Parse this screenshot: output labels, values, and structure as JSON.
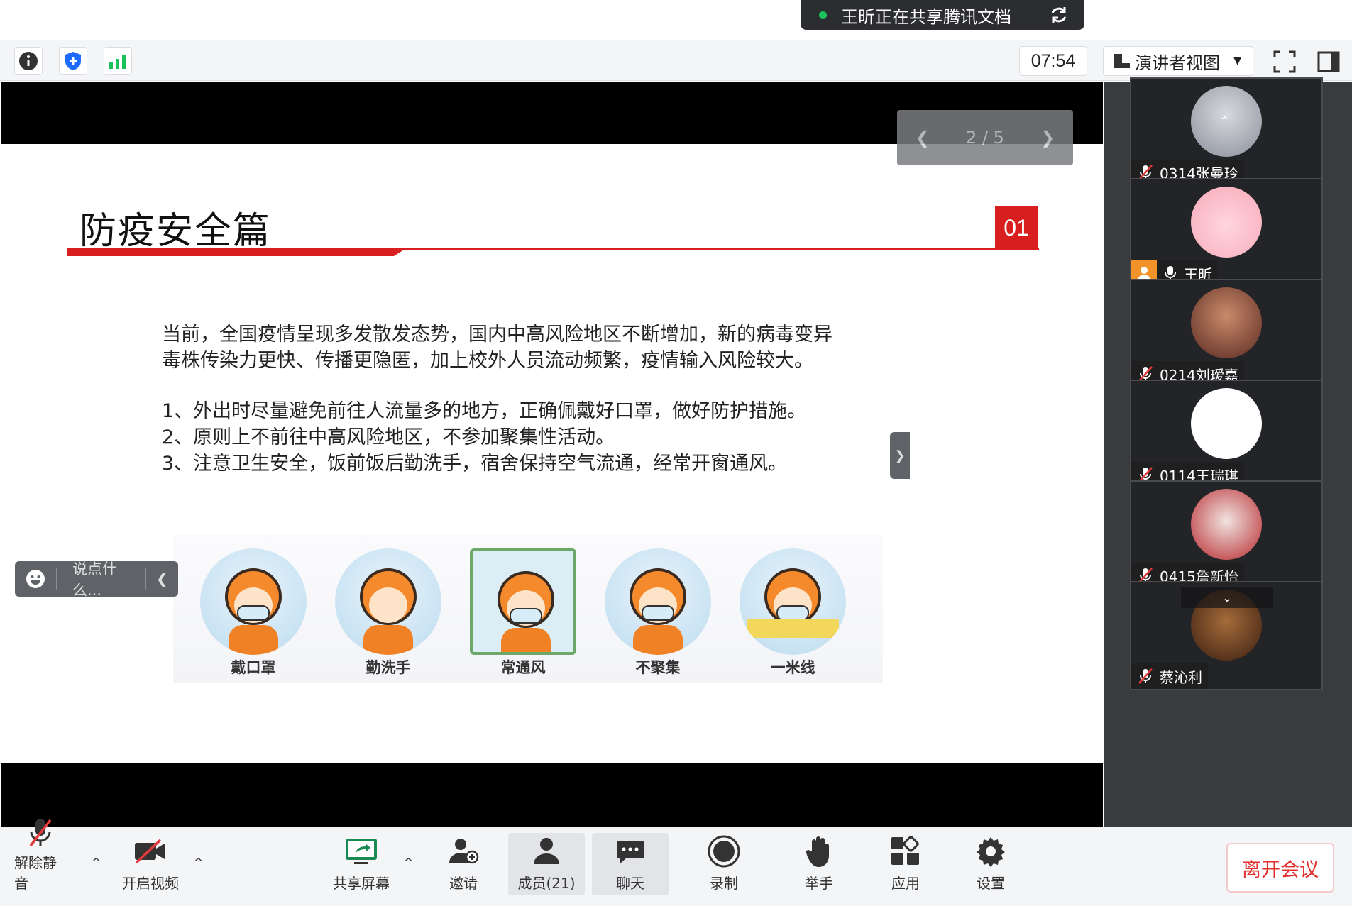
{
  "share_banner": {
    "text": "王昕正在共享腾讯文档",
    "status_color": "#19c25a"
  },
  "topbar": {
    "icons": [
      "info-icon",
      "shield-icon",
      "signal-icon"
    ],
    "timer": "07:54",
    "view_label": "演讲者视图",
    "fullscreen_icon": "fullscreen-icon",
    "panel_icon": "sidebar-toggle-icon"
  },
  "slide": {
    "pager": "2 / 5",
    "title": "防疫安全篇",
    "number": "01",
    "accent": "#d81e1e",
    "intro_line1": "当前，全国疫情呈现多发散发态势，国内中高风险地区不断增加，新的病毒变异",
    "intro_line2": "毒株传染力更快、传播更隐匿，加上校外人员流动频繁，疫情输入风险较大。",
    "rule1": "1、外出时尽量避免前往人流量多的地方，正确佩戴好口罩，做好防护措施。",
    "rule2": "2、原则上不前往中高风险地区，不参加聚集性活动。",
    "rule3": "3、注意卫生安全，饭前饭后勤洗手，宿舍保持空气流通，经常开窗通风。",
    "illustrations": [
      "戴口罩",
      "勤洗手",
      "常通风",
      "不聚集",
      "一米线"
    ]
  },
  "chat": {
    "placeholder": "说点什么..."
  },
  "participants": [
    {
      "name": "0314张曼玲",
      "muted": true
    },
    {
      "name": "王昕",
      "muted": false,
      "host": true
    },
    {
      "name": "0214刘瑷嘉",
      "muted": true
    },
    {
      "name": "0114王瑞琪",
      "muted": true
    },
    {
      "name": "0415詹新怡",
      "muted": true
    },
    {
      "name": "蔡沁利",
      "muted": true
    }
  ],
  "bottombar": {
    "unmute": "解除静音",
    "start_video": "开启视频",
    "share_screen": "共享屏幕",
    "invite": "邀请",
    "members": "成员(21)",
    "chat": "聊天",
    "record": "录制",
    "raise_hand": "举手",
    "apps": "应用",
    "settings": "设置",
    "leave": "离开会议"
  }
}
